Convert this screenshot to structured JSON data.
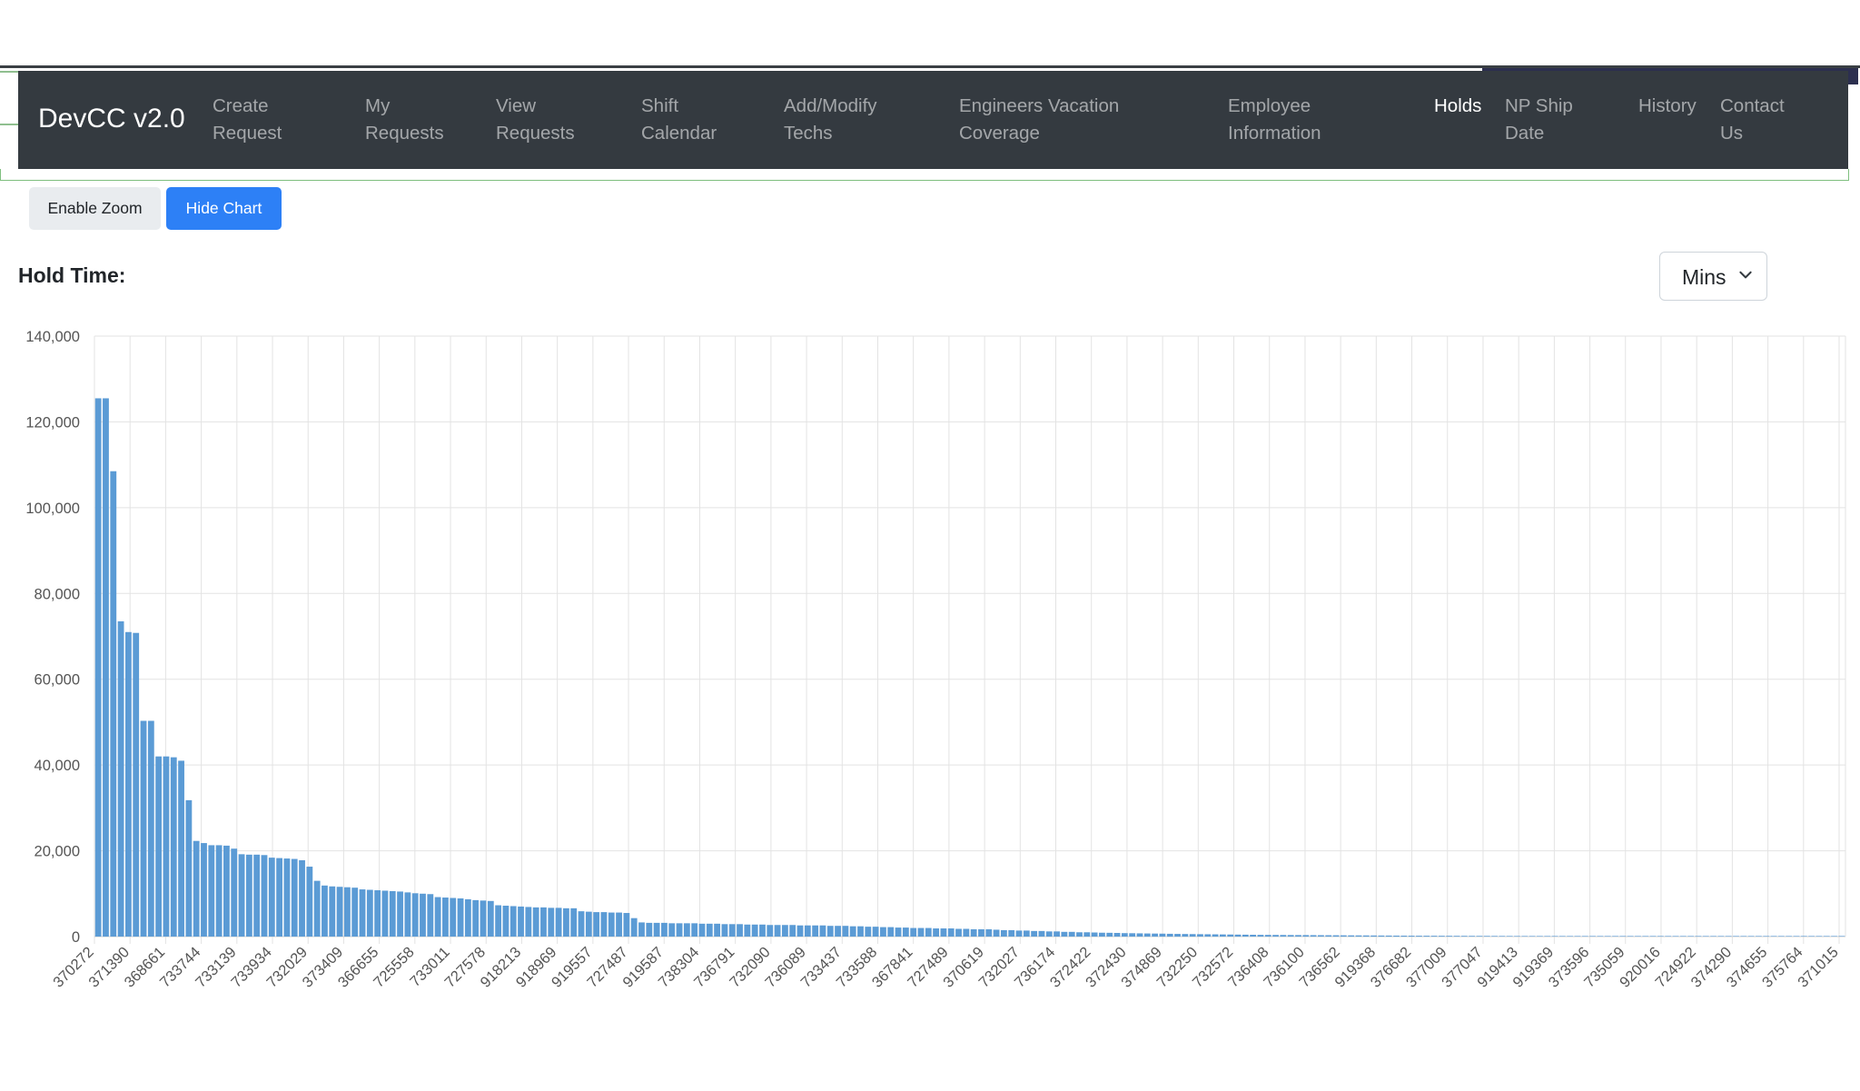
{
  "navbar": {
    "brand": "DevCC v2.0",
    "items": [
      {
        "line1": "Create",
        "line2": "Request"
      },
      {
        "line1": "My",
        "line2": "Requests"
      },
      {
        "line1": "View",
        "line2": "Requests"
      },
      {
        "line1": "Shift",
        "line2": "Calendar"
      },
      {
        "line1": "Add/Modify",
        "line2": "Techs"
      },
      {
        "line1": "Engineers Vacation",
        "line2": "Coverage"
      },
      {
        "line1": "Employee",
        "line2": "Information"
      },
      {
        "line1": "Holds",
        "line2": ""
      },
      {
        "line1": "NP Ship",
        "line2": "Date"
      },
      {
        "line1": "History",
        "line2": ""
      },
      {
        "line1": "Contact",
        "line2": "Us"
      }
    ],
    "active": "Holds"
  },
  "controls": {
    "zoom_label": "Enable Zoom",
    "hide_chart_label": "Hide Chart",
    "hold_time_label": "Hold Time:",
    "unit_select": "Mins"
  },
  "colors": {
    "navbar": "#343a40",
    "primary": "#2d80f6",
    "bar": "#5b9bd5"
  },
  "chart_data": {
    "type": "bar",
    "title": "",
    "xlabel": "",
    "ylabel": "",
    "ylim": [
      0,
      140000
    ],
    "yticks": [
      "0",
      "20,000",
      "40,000",
      "60,000",
      "80,000",
      "100,000",
      "120,000",
      "140,000"
    ],
    "grid": true,
    "legend": "none",
    "x_tick_labels": [
      "370272",
      "371390",
      "368661",
      "733744",
      "733139",
      "733934",
      "732029",
      "373409",
      "366655",
      "725558",
      "733011",
      "727578",
      "918213",
      "918969",
      "919557",
      "727487",
      "919587",
      "738304",
      "736791",
      "732090",
      "736089",
      "733437",
      "733588",
      "367841",
      "727489",
      "370619",
      "732027",
      "736174",
      "372422",
      "372430",
      "374869",
      "732250",
      "732572",
      "736408",
      "736100",
      "736562",
      "919368",
      "376682",
      "377009",
      "377047",
      "919413",
      "919369",
      "373596",
      "735059",
      "920016",
      "724922",
      "374290",
      "374655",
      "375764",
      "371015"
    ],
    "values": [
      125500,
      125500,
      108500,
      73500,
      71000,
      70800,
      50300,
      50300,
      42000,
      42000,
      41800,
      41000,
      31800,
      22300,
      21800,
      21300,
      21300,
      21200,
      20500,
      19200,
      19100,
      19100,
      19000,
      18400,
      18300,
      18200,
      18100,
      17800,
      16300,
      13000,
      11900,
      11700,
      11600,
      11500,
      11400,
      11000,
      10900,
      10800,
      10700,
      10600,
      10500,
      10300,
      10100,
      10000,
      9900,
      9200,
      9100,
      9000,
      8900,
      8700,
      8500,
      8400,
      8300,
      7300,
      7200,
      7100,
      7000,
      6900,
      6800,
      6800,
      6700,
      6700,
      6600,
      6600,
      5900,
      5800,
      5700,
      5700,
      5600,
      5600,
      5500,
      4300,
      3300,
      3200,
      3200,
      3200,
      3100,
      3100,
      3100,
      3100,
      3000,
      3000,
      3000,
      2900,
      2900,
      2900,
      2800,
      2800,
      2800,
      2700,
      2700,
      2700,
      2700,
      2600,
      2600,
      2600,
      2600,
      2500,
      2500,
      2500,
      2400,
      2400,
      2300,
      2300,
      2200,
      2200,
      2100,
      2100,
      2000,
      2000,
      2000,
      1900,
      1900,
      1900,
      1800,
      1800,
      1700,
      1700,
      1700,
      1600,
      1500,
      1500,
      1400,
      1400,
      1300,
      1300,
      1200,
      1200,
      1100,
      1100,
      1000,
      1000,
      950,
      900,
      880,
      850,
      800,
      780,
      750,
      720,
      700,
      680,
      650,
      620,
      600,
      580,
      560,
      540,
      520,
      500,
      480,
      460,
      440,
      420,
      400,
      390,
      380,
      370,
      360,
      350,
      340,
      330,
      320,
      310,
      300,
      290,
      280,
      270,
      260,
      250,
      240,
      230,
      220,
      210,
      200,
      195,
      190,
      185,
      180,
      175,
      170,
      165,
      160,
      155,
      150,
      145,
      140,
      135,
      130,
      125,
      120,
      115,
      110,
      105,
      100,
      95,
      90,
      85,
      80,
      75,
      70,
      65,
      60,
      55,
      50,
      45,
      40,
      35,
      30,
      28,
      26,
      24,
      22,
      20,
      18,
      16,
      14,
      12,
      10,
      9,
      8,
      7,
      6,
      5,
      4,
      3,
      2,
      2,
      1,
      1,
      1,
      1
    ]
  }
}
